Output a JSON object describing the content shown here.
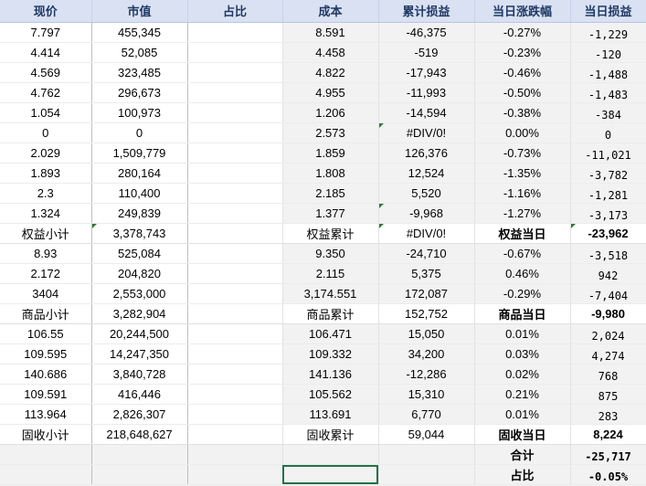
{
  "headers": [
    "现价",
    "市值",
    "占比",
    "成本",
    "累计损益",
    "当日涨跌幅",
    "当日损益"
  ],
  "rows": [
    {
      "price": "7.797",
      "mv": "455,345",
      "ratio": "",
      "cost": "8.591",
      "cum": "-46,375",
      "chg": "-0.27%",
      "pl": "-1,229"
    },
    {
      "price": "4.414",
      "mv": "52,085",
      "ratio": "",
      "cost": "4.458",
      "cum": "-519",
      "chg": "-0.23%",
      "pl": "-120"
    },
    {
      "price": "4.569",
      "mv": "323,485",
      "ratio": "",
      "cost": "4.822",
      "cum": "-17,943",
      "chg": "-0.46%",
      "pl": "-1,488"
    },
    {
      "price": "4.762",
      "mv": "296,673",
      "ratio": "",
      "cost": "4.955",
      "cum": "-11,993",
      "chg": "-0.50%",
      "pl": "-1,483"
    },
    {
      "price": "1.054",
      "mv": "100,973",
      "ratio": "",
      "cost": "1.206",
      "cum": "-14,594",
      "chg": "-0.38%",
      "pl": "-384"
    },
    {
      "price": "0",
      "mv": "0",
      "ratio": "",
      "cost": "2.573",
      "cum": "#DIV/0!",
      "chg": "0.00%",
      "pl": "0",
      "tri_cum": true
    },
    {
      "price": "2.029",
      "mv": "1,509,779",
      "ratio": "",
      "cost": "1.859",
      "cum": "126,376",
      "chg": "-0.73%",
      "pl": "-11,021"
    },
    {
      "price": "1.893",
      "mv": "280,164",
      "ratio": "",
      "cost": "1.808",
      "cum": "12,524",
      "chg": "-1.35%",
      "pl": "-3,782"
    },
    {
      "price": "2.3",
      "mv": "110,400",
      "ratio": "",
      "cost": "2.185",
      "cum": "5,520",
      "chg": "-1.16%",
      "pl": "-1,281"
    },
    {
      "price": "1.324",
      "mv": "249,839",
      "ratio": "",
      "cost": "1.377",
      "cum": "-9,968",
      "chg": "-1.27%",
      "pl": "-3,173",
      "tri_cum": true
    },
    {
      "type": "sub",
      "price": "权益小计",
      "mv": "3,378,743",
      "ratio": "",
      "cost": "权益累计",
      "cum": "#DIV/0!",
      "chg": "权益当日",
      "pl": "-23,962",
      "tri_mv": true,
      "tri_cum": true,
      "tri_pl": true
    },
    {
      "price": "8.93",
      "mv": "525,084",
      "ratio": "",
      "cost": "9.350",
      "cum": "-24,710",
      "chg": "-0.67%",
      "pl": "-3,518"
    },
    {
      "price": "2.172",
      "mv": "204,820",
      "ratio": "",
      "cost": "2.115",
      "cum": "5,375",
      "chg": "0.46%",
      "pl": "942"
    },
    {
      "price": "3404",
      "mv": "2,553,000",
      "ratio": "",
      "cost": "3,174.551",
      "cum": "172,087",
      "chg": "-0.29%",
      "pl": "-7,404"
    },
    {
      "type": "sub",
      "price": "商品小计",
      "mv": "3,282,904",
      "ratio": "",
      "cost": "商品累计",
      "cum": "152,752",
      "chg": "商品当日",
      "pl": "-9,980"
    },
    {
      "price": "106.55",
      "mv": "20,244,500",
      "ratio": "",
      "cost": "106.471",
      "cum": "15,050",
      "chg": "0.01%",
      "pl": "2,024"
    },
    {
      "price": "109.595",
      "mv": "14,247,350",
      "ratio": "",
      "cost": "109.332",
      "cum": "34,200",
      "chg": "0.03%",
      "pl": "4,274"
    },
    {
      "price": "140.686",
      "mv": "3,840,728",
      "ratio": "",
      "cost": "141.136",
      "cum": "-12,286",
      "chg": "0.02%",
      "pl": "768"
    },
    {
      "price": "109.591",
      "mv": "416,446",
      "ratio": "",
      "cost": "105.562",
      "cum": "15,310",
      "chg": "0.21%",
      "pl": "875"
    },
    {
      "price": "113.964",
      "mv": "2,826,307",
      "ratio": "",
      "cost": "113.691",
      "cum": "6,770",
      "chg": "0.01%",
      "pl": "283"
    },
    {
      "type": "sub",
      "price": "固收小计",
      "mv": "218,648,627",
      "ratio": "",
      "cost": "固收累计",
      "cum": "59,044",
      "chg": "固收当日",
      "pl": "8,224"
    },
    {
      "type": "summary",
      "price": "",
      "mv": "",
      "ratio": "",
      "cost": "",
      "cum": "",
      "chg": "合计",
      "pl": "-25,717"
    },
    {
      "type": "summary",
      "price": "",
      "mv": "",
      "ratio": "",
      "cost": "",
      "cum": "",
      "chg": "占比",
      "pl": "-0.05%"
    }
  ]
}
